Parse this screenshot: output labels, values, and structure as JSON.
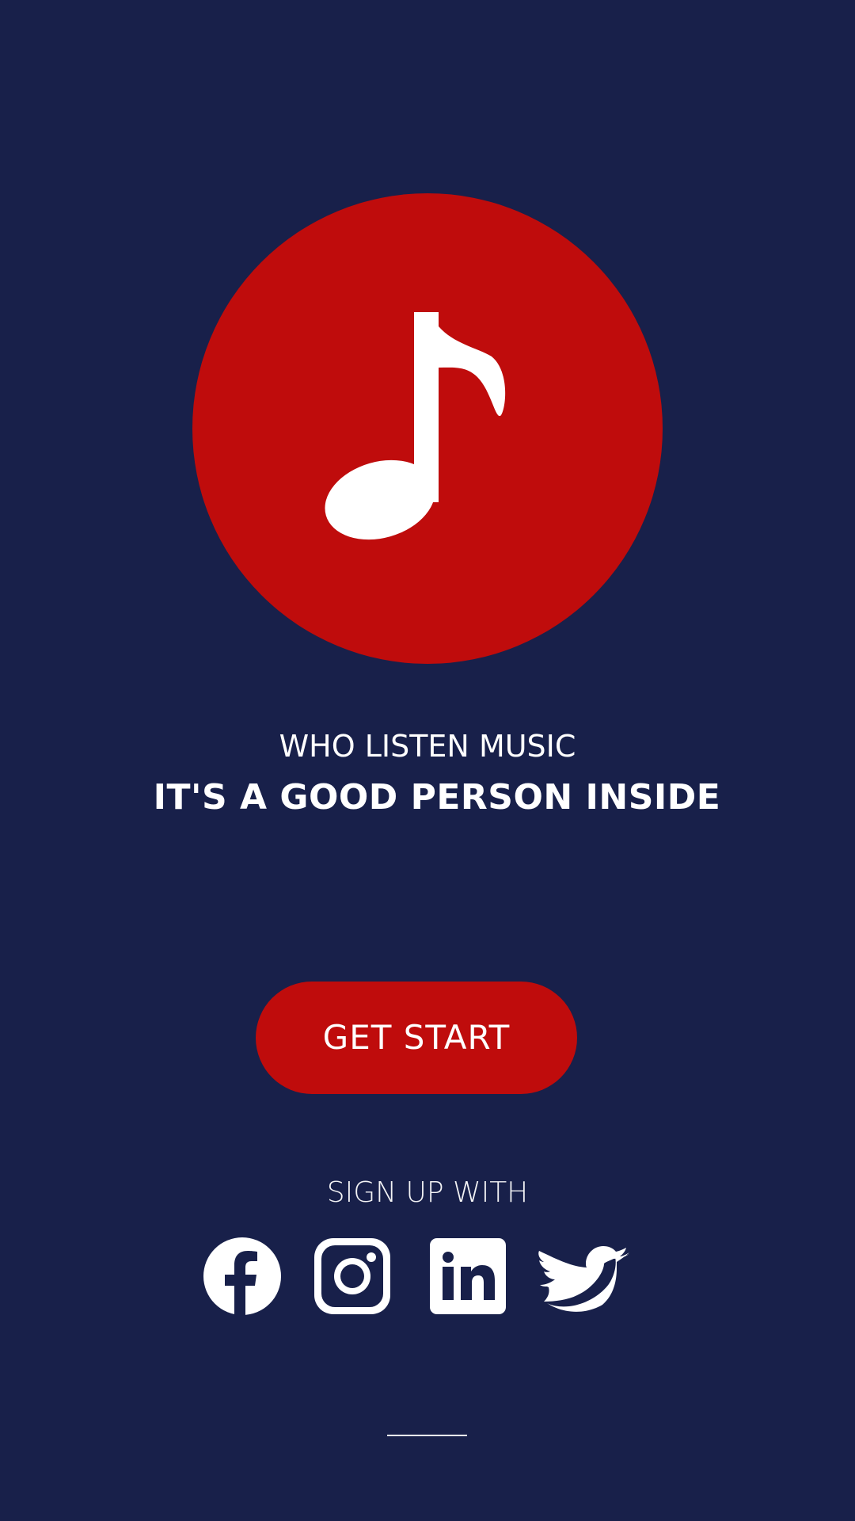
{
  "logo": {
    "icon": "music-note-icon",
    "circle_color": "#bf0c0c"
  },
  "hero": {
    "subtitle": "WHO LISTEN MUSIC",
    "headline": "IT'S A GOOD PERSON INSIDE"
  },
  "cta": {
    "label": "GET START"
  },
  "signup": {
    "label": "SIGN UP WITH",
    "providers": [
      {
        "icon": "facebook-icon"
      },
      {
        "icon": "instagram-icon"
      },
      {
        "icon": "linkedin-icon"
      },
      {
        "icon": "twitter-icon"
      }
    ]
  },
  "colors": {
    "background": "#18204a",
    "accent": "#bf0c0c",
    "text": "#ffffff"
  }
}
